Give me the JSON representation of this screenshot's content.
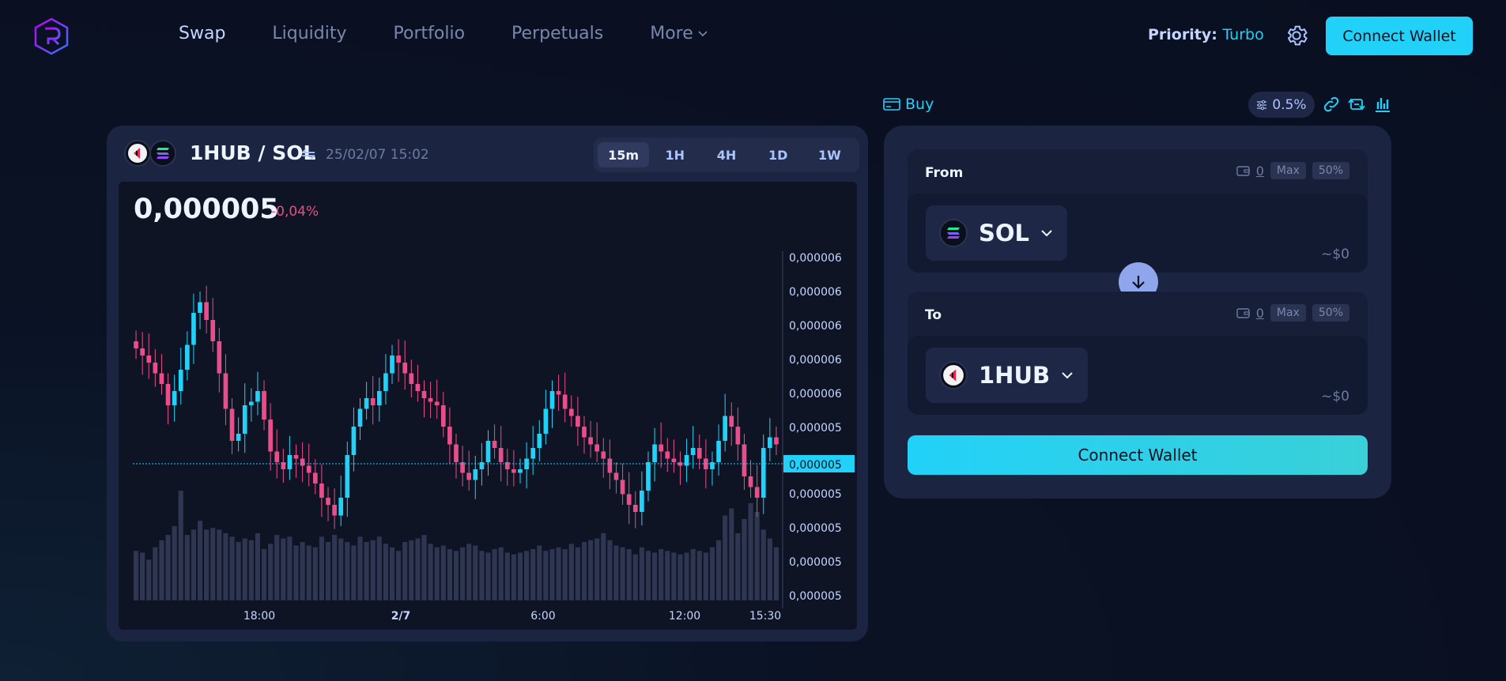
{
  "header": {
    "nav": [
      {
        "label": "Swap",
        "active": true
      },
      {
        "label": "Liquidity",
        "active": false
      },
      {
        "label": "Portfolio",
        "active": false
      },
      {
        "label": "Perpetuals",
        "active": false
      },
      {
        "label": "More",
        "active": false
      }
    ],
    "priority_label": "Priority:",
    "priority_value": "Turbo",
    "connect_label": "Connect Wallet"
  },
  "chart": {
    "pair": "1HUB / SOL",
    "timestamp": "25/02/07 15:02",
    "timeframes": [
      {
        "label": "15m",
        "active": true
      },
      {
        "label": "1H",
        "active": false
      },
      {
        "label": "4H",
        "active": false
      },
      {
        "label": "1D",
        "active": false
      },
      {
        "label": "1W",
        "active": false
      }
    ],
    "price": "0,000005",
    "change": "-0,04%"
  },
  "chart_data": {
    "type": "candlestick",
    "y_ticks": [
      "0,000006",
      "0,000006",
      "0,000006",
      "0,000006",
      "0,000006",
      "0,000005",
      "0,000005",
      "0,000005",
      "0,000005",
      "0,000005"
    ],
    "current_price_label": "0,000005",
    "x_ticks": [
      "18:00",
      "2/7",
      "6:00",
      "12:00",
      "15:30"
    ],
    "up_color": "#22d1f8",
    "down_color": "#e84f8a",
    "closes": [
      0.62,
      0.6,
      0.58,
      0.55,
      0.52,
      0.46,
      0.5,
      0.56,
      0.63,
      0.72,
      0.75,
      0.7,
      0.64,
      0.55,
      0.45,
      0.36,
      0.38,
      0.46,
      0.47,
      0.5,
      0.42,
      0.33,
      0.3,
      0.28,
      0.32,
      0.31,
      0.29,
      0.27,
      0.24,
      0.2,
      0.18,
      0.15,
      0.2,
      0.32,
      0.4,
      0.45,
      0.48,
      0.46,
      0.5,
      0.55,
      0.6,
      0.58,
      0.55,
      0.52,
      0.5,
      0.48,
      0.47,
      0.46,
      0.4,
      0.35,
      0.3,
      0.27,
      0.25,
      0.28,
      0.3,
      0.36,
      0.34,
      0.3,
      0.28,
      0.27,
      0.28,
      0.31,
      0.34,
      0.38,
      0.45,
      0.5,
      0.49,
      0.45,
      0.43,
      0.4,
      0.37,
      0.35,
      0.33,
      0.31,
      0.27,
      0.25,
      0.21,
      0.18,
      0.16,
      0.22,
      0.3,
      0.35,
      0.33,
      0.31,
      0.3,
      0.29,
      0.32,
      0.34,
      0.31,
      0.28,
      0.3,
      0.36,
      0.43,
      0.4,
      0.35,
      0.26,
      0.23,
      0.2,
      0.34,
      0.37,
      0.35
    ],
    "volumes": [
      0.28,
      0.27,
      0.23,
      0.3,
      0.34,
      0.37,
      0.42,
      0.62,
      0.37,
      0.4,
      0.45,
      0.4,
      0.41,
      0.4,
      0.38,
      0.36,
      0.33,
      0.35,
      0.34,
      0.38,
      0.29,
      0.32,
      0.37,
      0.35,
      0.36,
      0.31,
      0.33,
      0.31,
      0.3,
      0.36,
      0.33,
      0.37,
      0.35,
      0.33,
      0.31,
      0.36,
      0.33,
      0.34,
      0.36,
      0.32,
      0.3,
      0.28,
      0.33,
      0.34,
      0.35,
      0.37,
      0.32,
      0.3,
      0.31,
      0.29,
      0.28,
      0.3,
      0.32,
      0.31,
      0.28,
      0.27,
      0.29,
      0.3,
      0.27,
      0.26,
      0.27,
      0.28,
      0.29,
      0.31,
      0.28,
      0.29,
      0.3,
      0.29,
      0.32,
      0.3,
      0.33,
      0.34,
      0.35,
      0.38,
      0.34,
      0.31,
      0.3,
      0.29,
      0.26,
      0.3,
      0.28,
      0.27,
      0.29,
      0.28,
      0.27,
      0.26,
      0.27,
      0.29,
      0.28,
      0.27,
      0.3,
      0.34,
      0.48,
      0.52,
      0.38,
      0.46,
      0.55,
      0.5,
      0.4,
      0.35,
      0.3
    ]
  },
  "trade": {
    "buy_label": "Buy",
    "slippage": "0.5%",
    "from_label": "From",
    "to_label": "To",
    "from_balance": "0",
    "to_balance": "0",
    "max_label": "Max",
    "half_label": "50%",
    "from_token": "SOL",
    "to_token": "1HUB",
    "from_usd": "~$0",
    "to_usd": "~$0",
    "connect_label": "Connect Wallet"
  }
}
